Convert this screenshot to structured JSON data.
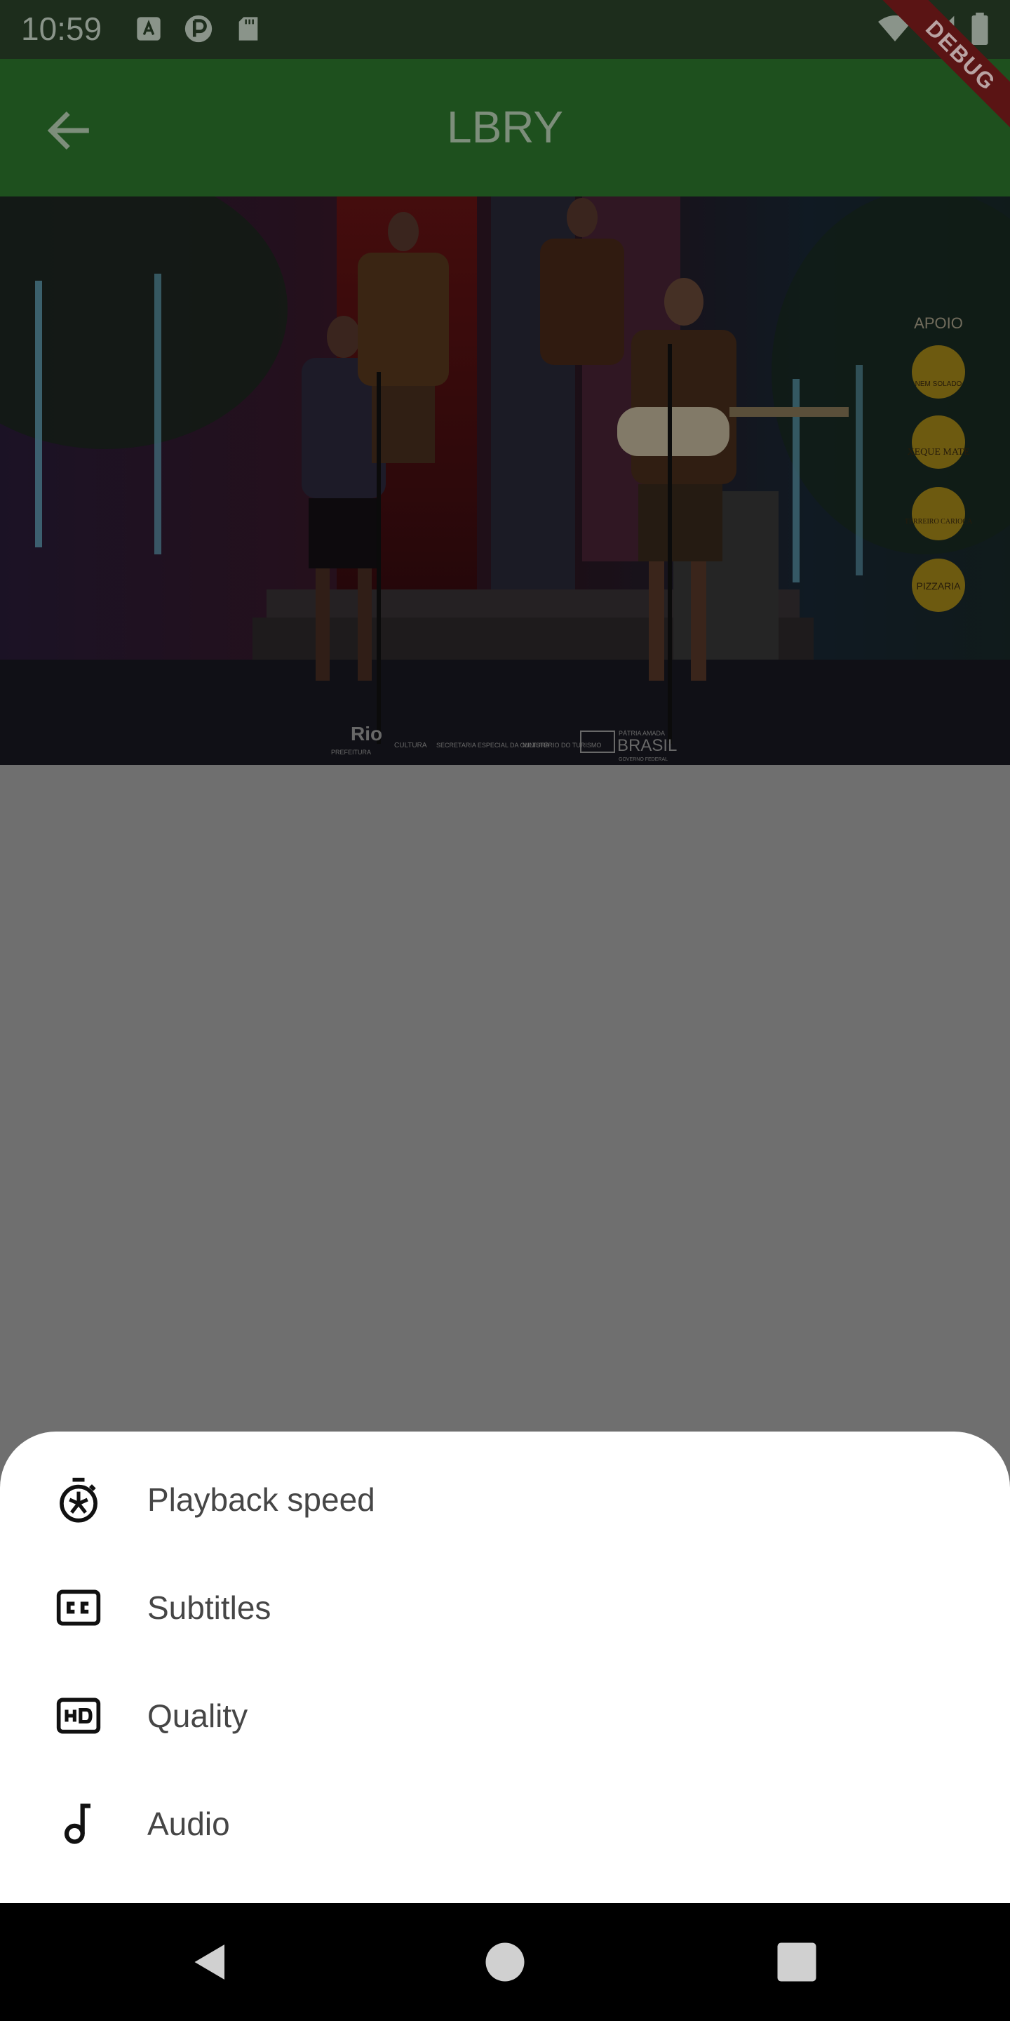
{
  "status_bar": {
    "time": "10:59",
    "left_icons": [
      "a-notification-icon",
      "app-notification-icon",
      "sd-card-icon"
    ],
    "right_icons": [
      "wifi-icon",
      "signal-icon",
      "battery-icon"
    ]
  },
  "debug_banner": {
    "label": "DEBUG"
  },
  "app_bar": {
    "title": "LBRY"
  },
  "video": {
    "overlay_text": {
      "sponsor_header": "APOIO",
      "sponsor_1": "NEM SOLADO",
      "sponsor_2": "XEQUE MATE",
      "sponsor_3": "TERREIRO CARIOCA",
      "sponsor_4": "PIZZARIA",
      "footer_rio": "Rio",
      "footer_rio_sub": "PREFEITURA",
      "footer_cultura": "CULTURA",
      "footer_secretaria": "SECRETARIA ESPECIAL DA CULTURA",
      "footer_ministerio": "MINISTÉRIO DO TURISMO",
      "footer_patria": "PÁTRIA AMADA",
      "footer_brasil": "BRASIL",
      "footer_gov": "GOVERNO FEDERAL"
    }
  },
  "sheet": {
    "items": [
      {
        "label": "Playback speed",
        "icon": "playback-speed-icon"
      },
      {
        "label": "Subtitles",
        "icon": "closed-captions-icon"
      },
      {
        "label": "Quality",
        "icon": "hd-quality-icon"
      },
      {
        "label": "Audio",
        "icon": "music-note-icon"
      }
    ]
  },
  "nav_bar": {
    "buttons": [
      "back-nav-icon",
      "home-nav-icon",
      "recents-nav-icon"
    ]
  },
  "colors": {
    "status_bar": "#1d2d1c",
    "app_bar": "#1e501e",
    "scrim": "#6f6f6f",
    "sheet": "#ffffff",
    "debug_ribbon": "#5a1414"
  }
}
